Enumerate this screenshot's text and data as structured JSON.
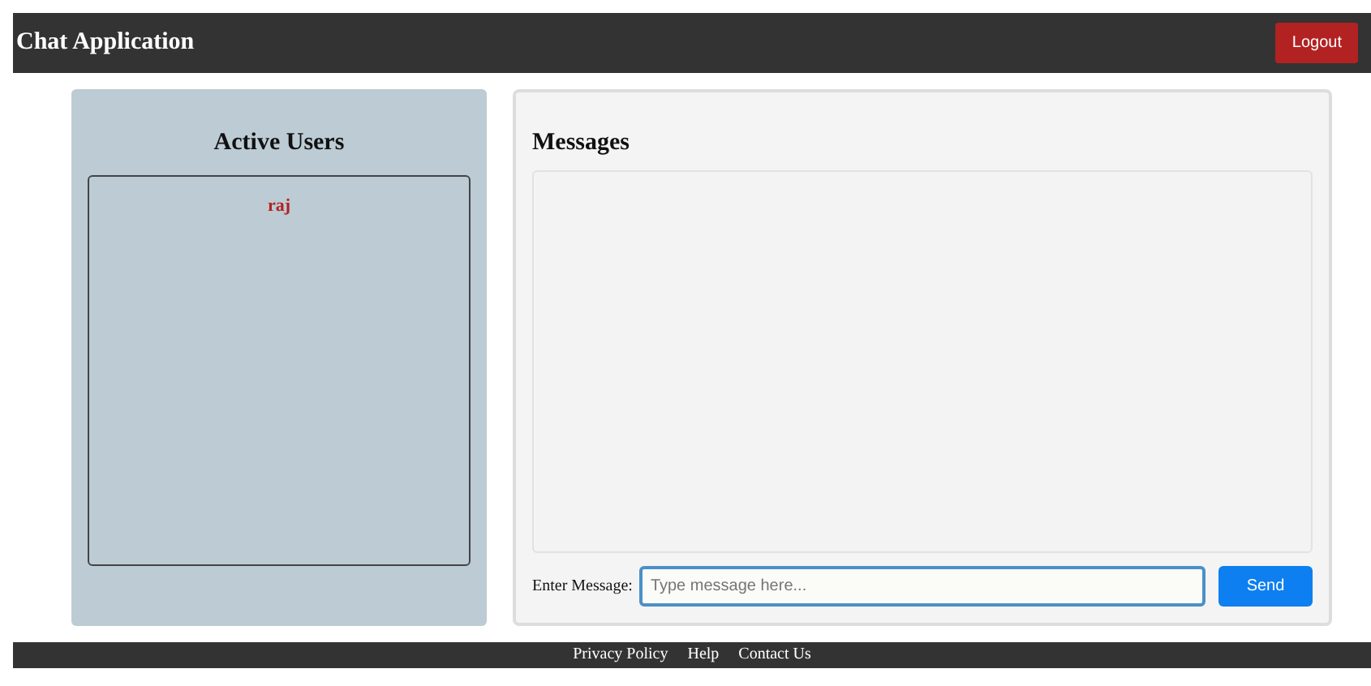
{
  "header": {
    "title": "Chat Application",
    "logout": "Logout"
  },
  "users_panel": {
    "title": "Active Users",
    "users": [
      {
        "name": "raj"
      }
    ]
  },
  "messages_panel": {
    "title": "Messages",
    "input_label": "Enter Message:",
    "placeholder": "Type message here...",
    "send": "Send"
  },
  "footer": {
    "links": [
      "Privacy Policy",
      "Help",
      "Contact Us"
    ]
  }
}
